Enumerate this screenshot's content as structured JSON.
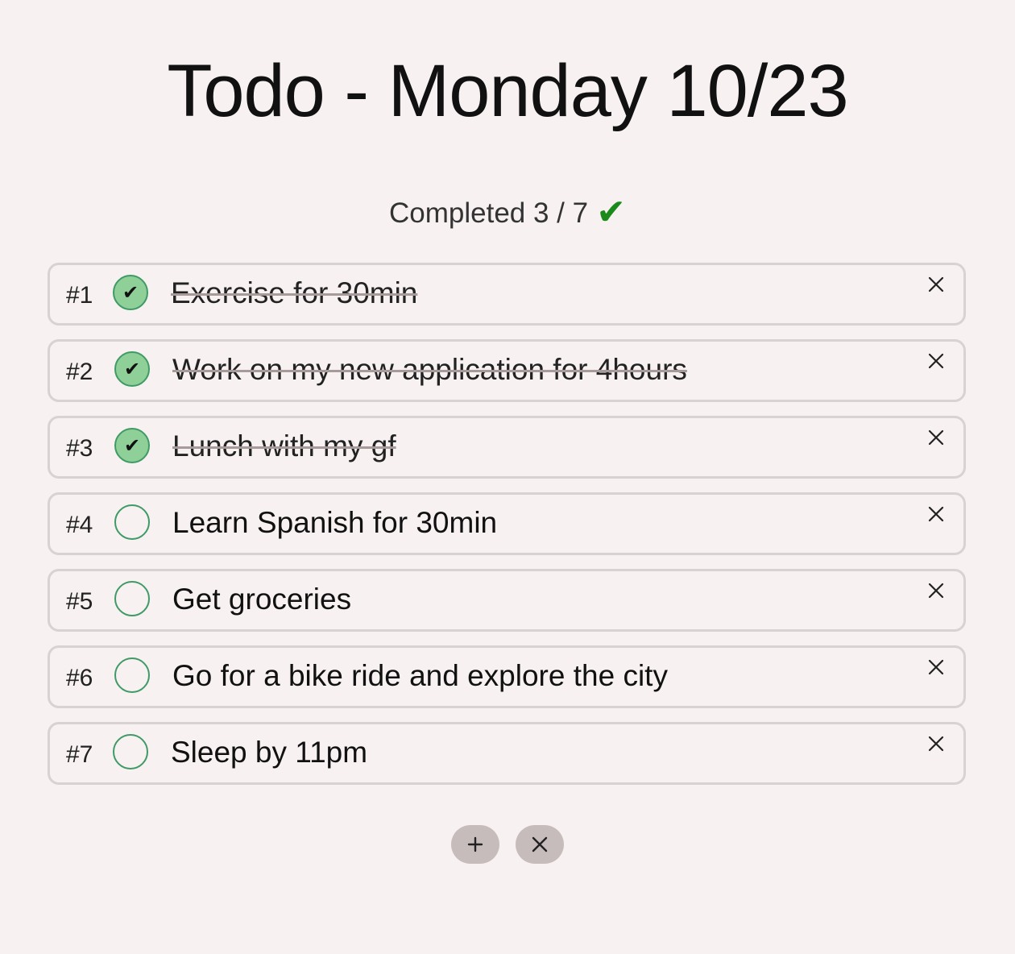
{
  "header": {
    "title": "Todo - Monday 10/23"
  },
  "progress": {
    "label": "Completed 3 / 7",
    "completed": 3,
    "total": 7,
    "icon": "check-icon",
    "icon_glyph": "✔"
  },
  "todos": [
    {
      "number": "#1",
      "text": "Exercise for 30min",
      "done": true
    },
    {
      "number": "#2",
      "text": "Work on my new application for 4hours",
      "done": true
    },
    {
      "number": "#3",
      "text": "Lunch with my gf",
      "done": true
    },
    {
      "number": "#4",
      "text": "Learn Spanish for 30min",
      "done": false
    },
    {
      "number": "#5",
      "text": "Get groceries",
      "done": false
    },
    {
      "number": "#6",
      "text": "Go for a bike ride and explore the city",
      "done": false
    },
    {
      "number": "#7",
      "text": "Sleep by 11pm",
      "done": false
    }
  ],
  "actions": {
    "add_icon": "plus-icon",
    "clear_icon": "close-icon"
  },
  "colors": {
    "background": "#f7f1f1",
    "accent_green": "#1b8a1b",
    "done_fill": "#8fcf98",
    "circle_border": "#3f9a66",
    "button_bg": "#c6bcbc"
  }
}
